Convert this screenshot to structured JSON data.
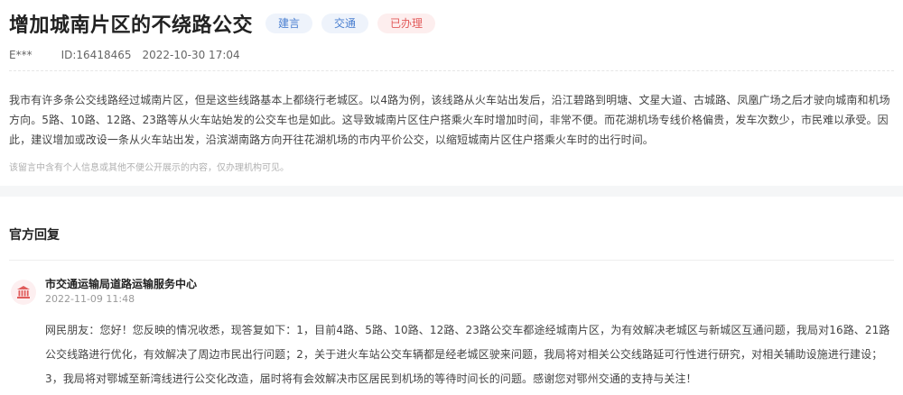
{
  "header": {
    "title": "增加城南片区的不绕路公交",
    "tags": [
      "建言",
      "交通",
      "已办理"
    ],
    "author": "E***",
    "id_text": "ID:16418465",
    "datetime": "2022-10-30 17:04"
  },
  "content": "我市有许多条公交线路经过城南片区，但是这些线路基本上都绕行老城区。以4路为例，该线路从火车站出发后，沿江碧路到明塘、文星大道、古城路、凤凰广场之后才驶向城南和机场方向。5路、10路、12路、23路等从火车站始发的公交车也是如此。这导致城南片区住户搭乘火车时增加时间，非常不便。而花湖机场专线价格偏贵，发车次数少，市民难以承受。因此，建议增加或改设一条从火车站出发，沿滨湖南路方向开往花湖机场的市内平价公交，以缩短城南片区住户搭乘火车时的出行时间。",
  "privacy_note": "该留言中含有个人信息或其他不便公开展示的内容，仅办理机构可见。",
  "reply": {
    "section_title": "官方回复",
    "org_name": "市交通运输局道路运输服务中心",
    "datetime": "2022-11-09 11:48",
    "text": "网民朋友：您好！您反映的情况收悉，现答复如下：1，目前4路、5路、10路、12路、23路公交车都途经城南片区，为有效解决老城区与新城区互通问题，我局对16路、21路公交线路进行优化，有效解决了周边市民出行问题；2，关于进火车站公交车辆都是经老城区驶来问题，我局将对相关公交线路延可行性进行研究，对相关辅助设施进行建设；3，我局将对鄂城至新湾线进行公交化改造，届时将有会效解决市区居民到机场的等待时间长的问题。感谢您对鄂州交通的支持与关注！"
  },
  "icons": {
    "org_avatar": "government-building-icon"
  },
  "colors": {
    "tag_blue": "#4a7fd0",
    "tag_red": "#e25b5b",
    "avatar_bg": "#fdeff0",
    "avatar_icon": "#e05c5c"
  }
}
